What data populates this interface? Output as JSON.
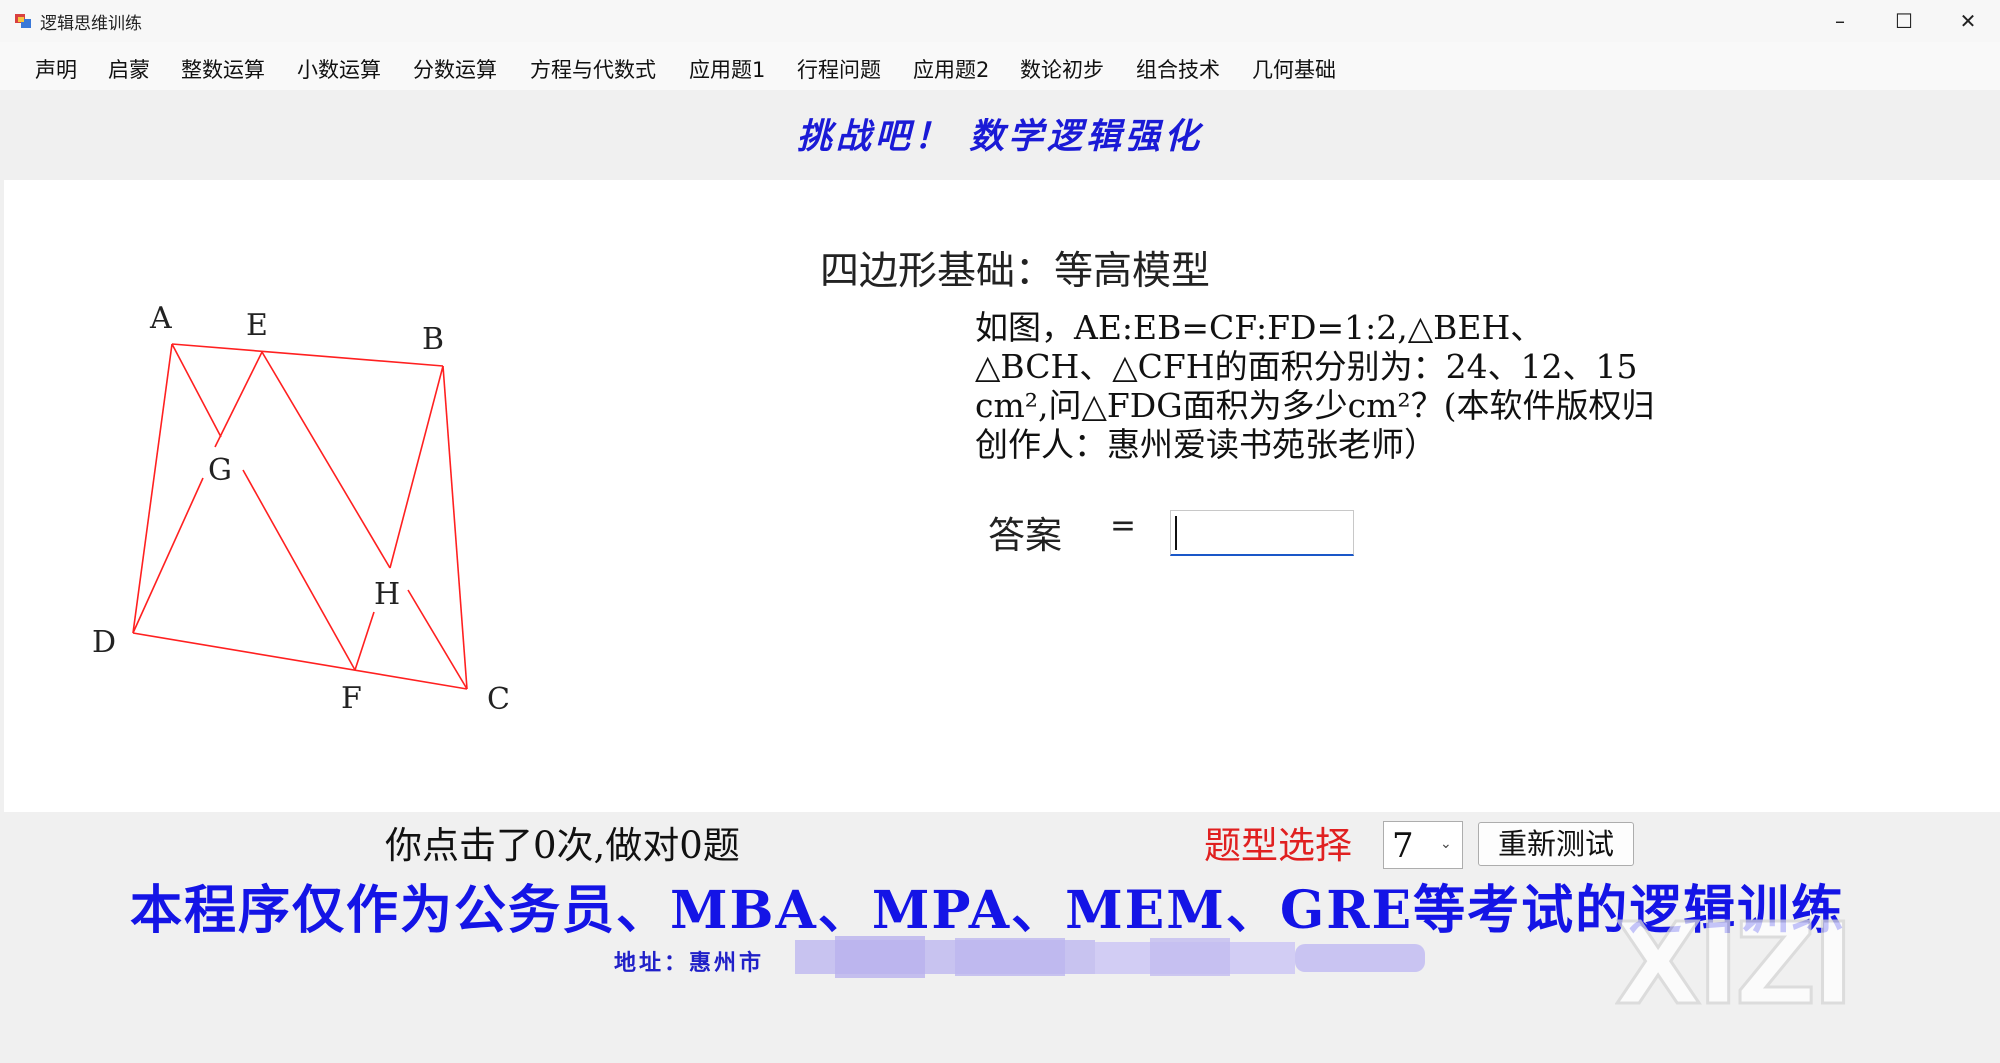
{
  "window": {
    "title": "逻辑思维训练",
    "minimize": "–",
    "maximize": "☐",
    "close": "✕"
  },
  "menu": [
    "声明",
    "启蒙",
    "整数运算",
    "小数运算",
    "分数运算",
    "方程与代数式",
    "应用题1",
    "行程问题",
    "应用题2",
    "数论初步",
    "组合技术",
    "几何基础"
  ],
  "banner": "挑战吧！ 数学逻辑强化",
  "problem": {
    "section_title": "四边形基础：等高模型",
    "question": "如图，AE:EB=CF:FD=1:2,△BEH、△BCH、△CFH的面积分别为：24、12、15 cm²,问△FDG面积为多少cm²？(本软件版权归创作人：惠州爱读书苑张老师）",
    "answer_label": "答案",
    "equals": "=",
    "answer_value": ""
  },
  "figure": {
    "line_color": "#ff2020",
    "labels": [
      "A",
      "E",
      "B",
      "G",
      "H",
      "D",
      "F",
      "C"
    ]
  },
  "footer": {
    "score": "你点击了0次,做对0题",
    "type_label": "题型选择",
    "type_value": "7",
    "retest_label": "重新测试",
    "disclaimer": "本程序仅作为公务员、MBA、MPA、MEM、GRE等考试的逻辑训练",
    "address_prefix": "地址：惠州市",
    "watermark": "XIZI"
  }
}
